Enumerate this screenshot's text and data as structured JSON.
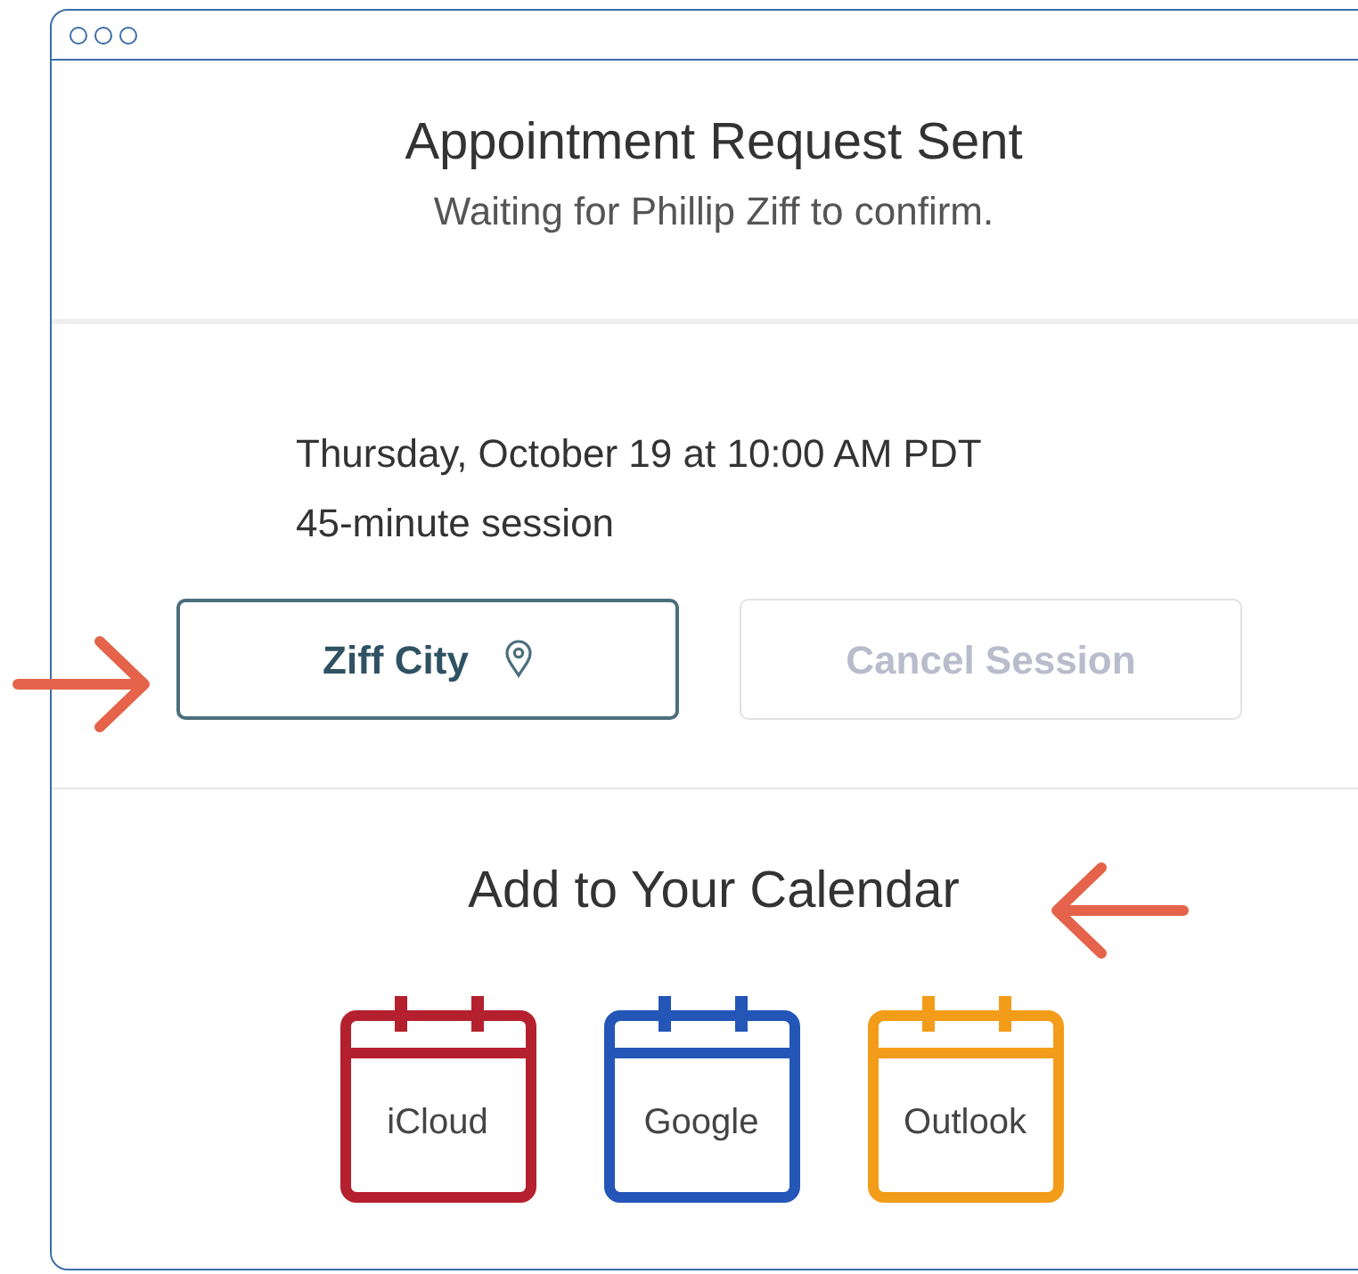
{
  "header": {
    "title": "Appointment Request Sent",
    "subtitle": "Waiting for Phillip Ziff to confirm."
  },
  "session": {
    "when": "Thursday, October 19 at 10:00 AM PDT",
    "length": "45-minute session"
  },
  "buttons": [
    {
      "label": "Ziff City",
      "kind": "location",
      "disabled": false
    },
    {
      "label": "Cancel Session",
      "kind": "plain",
      "disabled": true
    }
  ],
  "calendar_heading": "Add to Your Calendar",
  "calendars": [
    {
      "label": "iCloud",
      "color": "#b5202e"
    },
    {
      "label": "Google",
      "color": "#2456b8"
    },
    {
      "label": "Outlook",
      "color": "#f39c1a"
    }
  ]
}
